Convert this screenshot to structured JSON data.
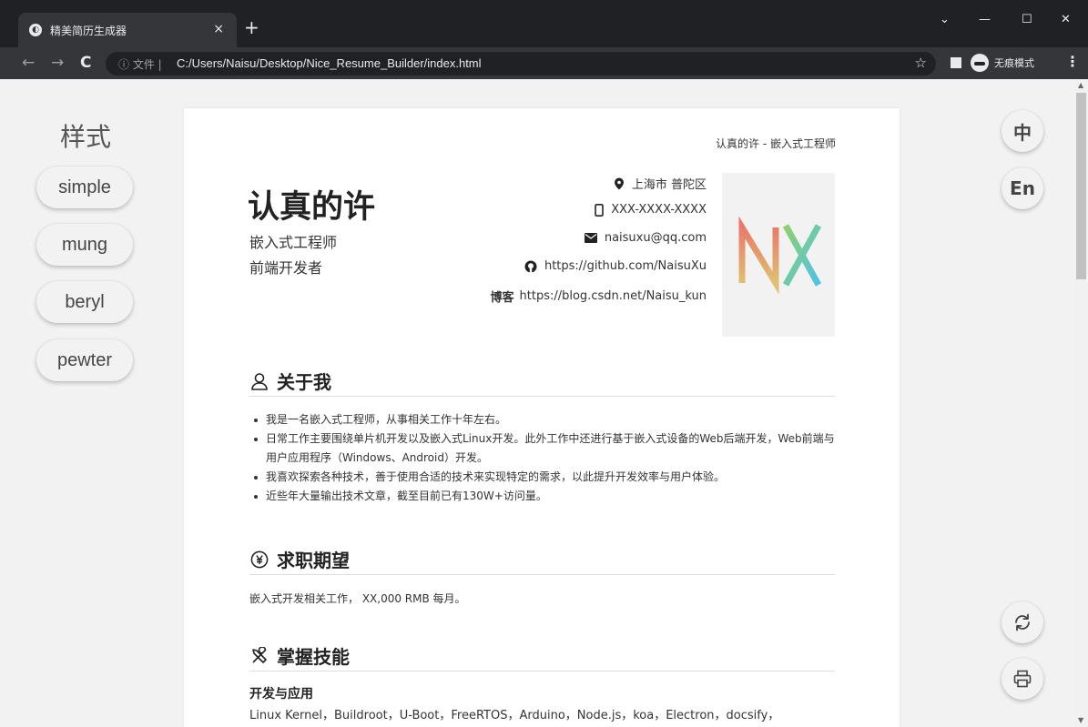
{
  "browser": {
    "tab_title": "精美简历生成器",
    "tab_close": "×",
    "new_tab": "+",
    "url_info_label": "ⓘ 文件 |",
    "url": "C:/Users/Naisu/Desktop/Nice_Resume_Builder/index.html",
    "incognito_label": "无痕模式",
    "win_minimize": "—",
    "win_maximize": "☐",
    "win_close": "✕",
    "win_dropdown": "⌄"
  },
  "sidebar": {
    "title": "样式",
    "styles": [
      "simple",
      "mung",
      "beryl",
      "pewter"
    ]
  },
  "lang_buttons": {
    "zh": "中",
    "en": "En"
  },
  "resume": {
    "header_right": "认真的许 - 嵌入式工程师",
    "name": "认真的许",
    "roles": [
      "嵌入式工程师",
      "前端开发者"
    ],
    "contact": {
      "location": "上海市 普陀区",
      "phone": "XXX-XXXX-XXXX",
      "email": "naisuxu@qq.com",
      "github": "https://github.com/NaisuXu",
      "blog_label": "博客",
      "blog": "https://blog.csdn.net/Naisu_kun"
    },
    "avatar_text": "NX",
    "about": {
      "title": "关于我",
      "items": [
        "我是一名嵌入式工程师，从事相关工作十年左右。",
        "日常工作主要围绕单片机开发以及嵌入式Linux开发。此外工作中还进行基于嵌入式设备的Web后端开发，Web前端与用户应用程序（Windows、Android）开发。",
        "我喜欢探索各种技术，善于使用合适的技术来实现特定的需求，以此提升开发效率与用户体验。",
        "近些年大量输出技术文章，截至目前已有130W+访问量。"
      ]
    },
    "expect": {
      "title": "求职期望",
      "text": "嵌入式开发相关工作， XX,000 RMB 每月。"
    },
    "skills": {
      "title": "掌握技能",
      "sub_title": "开发与应用",
      "text": "Linux Kernel，Buildroot，U-Boot，FreeRTOS，Arduino，Node.js，koa，Electron，docsify，"
    }
  },
  "colors": {
    "avatar_n": "#e97a6a",
    "avatar_x": "#4cc3e8",
    "accent": "#222222"
  }
}
